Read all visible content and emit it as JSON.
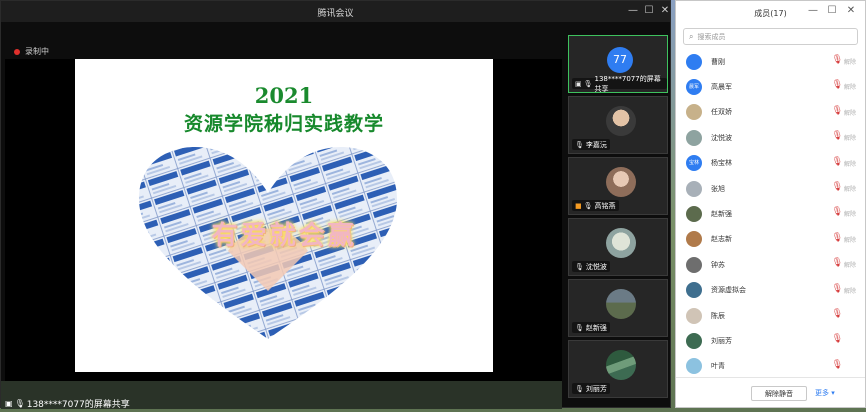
{
  "meeting": {
    "title": "腾讯会议",
    "controls": {
      "minimize": "—",
      "maximize": "☐",
      "close": "✕"
    },
    "recording_label": "录制中",
    "share_label": "138****7077的屏幕共享"
  },
  "slide": {
    "year": "2021",
    "title": "资源学院秭归实践教学",
    "overlay_text": "有爱就会赢",
    "colors": {
      "title": "#17892c",
      "overlay": "#f2b6c2"
    }
  },
  "video_tiles": [
    {
      "avatar_text": "77",
      "label": "138****7077的屏幕共享"
    },
    {
      "label": "李嘉沅"
    },
    {
      "label": "高铭燕"
    },
    {
      "label": "沈悦波"
    },
    {
      "label": "赵新强"
    },
    {
      "label": "刘丽芳"
    }
  ],
  "members_panel": {
    "title": "成员(17)",
    "controls": {
      "minimize": "—",
      "maximize": "☐",
      "close": "✕"
    },
    "search_placeholder": "搜索成员",
    "members": [
      {
        "name": "曹刚",
        "avatar_color": "#2f7df1",
        "avatar_text": "",
        "muted": true,
        "action": "解除"
      },
      {
        "name": "高晨军",
        "avatar_color": "#2f7df1",
        "avatar_text": "晨军",
        "muted": true,
        "action": "解除"
      },
      {
        "name": "任双娇",
        "avatar_color": "#c7b18a",
        "avatar_text": "",
        "muted": true,
        "action": "解除"
      },
      {
        "name": "沈悦波",
        "avatar_color": "#8ea3a0",
        "avatar_text": "",
        "muted": true,
        "action": "解除"
      },
      {
        "name": "杨宝林",
        "avatar_color": "#2f7df1",
        "avatar_text": "宝林",
        "muted": true,
        "action": "解除"
      },
      {
        "name": "张旭",
        "avatar_color": "#a8b0b8",
        "avatar_text": "",
        "muted": true,
        "action": "解除"
      },
      {
        "name": "赵新强",
        "avatar_color": "#5c6b4d",
        "avatar_text": "",
        "muted": true,
        "action": "解除"
      },
      {
        "name": "赵志新",
        "avatar_color": "#b07a4a",
        "avatar_text": "",
        "muted": true,
        "action": "解除"
      },
      {
        "name": "钟苏",
        "avatar_color": "#6e6e6e",
        "avatar_text": "",
        "muted": true,
        "action": "解除"
      },
      {
        "name": "资源虚拟会",
        "avatar_color": "#3f6f8f",
        "avatar_text": "",
        "muted": true,
        "action": "解除"
      },
      {
        "name": "陈辰",
        "avatar_color": "#d0c4b6",
        "avatar_text": "",
        "muted": true,
        "action": ""
      },
      {
        "name": "刘丽芳",
        "avatar_color": "#3d6b52",
        "avatar_text": "",
        "muted": true,
        "action": ""
      },
      {
        "name": "叶青",
        "avatar_color": "#8cc2e0",
        "avatar_text": "",
        "muted": true,
        "action": ""
      }
    ],
    "mute_all_label": "解除静音",
    "more_label": "更多"
  },
  "colors": {
    "accent": "#2f7df1",
    "active_border": "#3ec25e",
    "recording": "#e0302c",
    "muted": "#d63b3b"
  }
}
